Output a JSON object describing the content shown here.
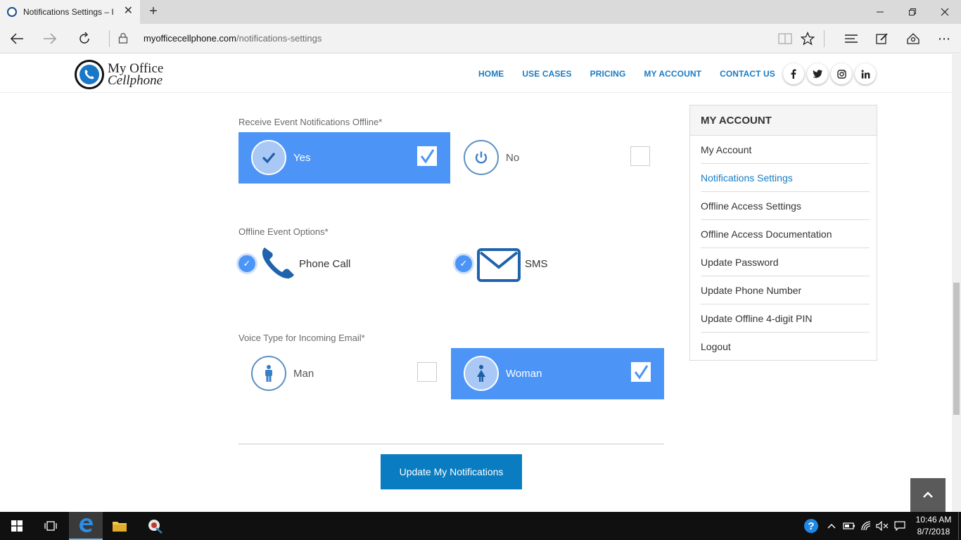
{
  "browser": {
    "tab_title": "Notifications Settings – I",
    "new_tab_symbol": "+",
    "url_domain": "myofficecellphone.com",
    "url_path": "/notifications-settings"
  },
  "site": {
    "logo_line1": "My Office",
    "logo_line2": "Cellphone",
    "nav": [
      {
        "label": "HOME"
      },
      {
        "label": "USE CASES"
      },
      {
        "label": "PRICING"
      },
      {
        "label": "MY ACCOUNT"
      },
      {
        "label": "CONTACT US"
      }
    ],
    "social": [
      "f",
      "t",
      "ig",
      "in"
    ]
  },
  "form": {
    "receive_offline": {
      "label": "Receive Event Notifications Offline*",
      "options": [
        {
          "label": "Yes",
          "checked": true
        },
        {
          "label": "No",
          "checked": false
        }
      ]
    },
    "offline_options": {
      "label": "Offline Event Options*",
      "options": [
        {
          "label": "Phone Call",
          "checked": true
        },
        {
          "label": "SMS",
          "checked": true
        }
      ]
    },
    "voice_type": {
      "label": "Voice Type for Incoming Email*",
      "options": [
        {
          "label": "Man",
          "checked": false
        },
        {
          "label": "Woman",
          "checked": true
        }
      ]
    },
    "submit_label": "Update My Notifications"
  },
  "sidebar": {
    "title": "MY ACCOUNT",
    "items": [
      {
        "label": "My Account"
      },
      {
        "label": "Notifications Settings",
        "active": true
      },
      {
        "label": "Offline Access Settings"
      },
      {
        "label": "Offline Access Documentation"
      },
      {
        "label": "Update Password"
      },
      {
        "label": "Update Phone Number"
      },
      {
        "label": "Update Offline 4-digit PIN"
      },
      {
        "label": "Logout"
      }
    ]
  },
  "taskbar": {
    "time": "10:46 AM",
    "date": "8/7/2018"
  },
  "colors": {
    "accent": "#4c95f7",
    "link": "#1a7bc4",
    "button": "#0a7cc1"
  }
}
